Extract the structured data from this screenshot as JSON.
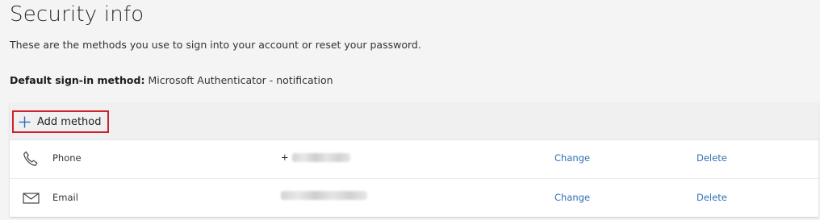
{
  "header": {
    "title": "Security info",
    "subtitle": "These are the methods you use to sign into your account or reset your password."
  },
  "default_method": {
    "label": "Default sign-in method:",
    "value": "Microsoft Authenticator - notification"
  },
  "panel": {
    "add_method_label": "Add method",
    "methods": [
      {
        "icon": "phone-icon",
        "name": "Phone",
        "value_prefix": "+",
        "change_label": "Change",
        "delete_label": "Delete"
      },
      {
        "icon": "email-icon",
        "name": "Email",
        "change_label": "Change",
        "delete_label": "Delete"
      }
    ]
  },
  "colors": {
    "background": "#f4f4f4",
    "panel_header": "#f0f0f0",
    "link": "#2f6fb5",
    "highlight_border": "#d0202a",
    "plus_icon": "#2f6fb5"
  }
}
